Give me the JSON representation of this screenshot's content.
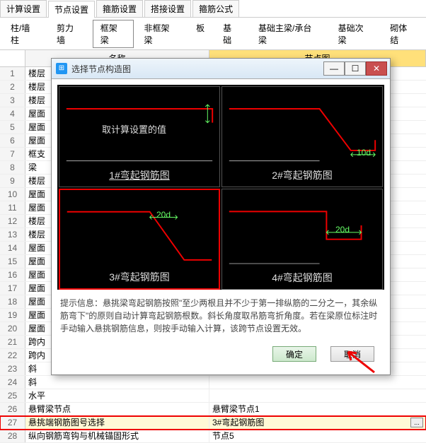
{
  "tabs_top": [
    "计算设置",
    "节点设置",
    "箍筋设置",
    "搭接设置",
    "箍筋公式"
  ],
  "tabs_top_active": 1,
  "tabs_sub": [
    "柱/墙柱",
    "剪力墙",
    "框架梁",
    "非框架梁",
    "板",
    "基础",
    "基础主梁/承台梁",
    "基础次梁",
    "砌体结"
  ],
  "tabs_sub_active": 2,
  "grid_headers": {
    "name": "名称",
    "img": "节点图"
  },
  "rows": [
    {
      "n": 1,
      "c1": "楼层",
      "c2": ""
    },
    {
      "n": 2,
      "c1": "楼层",
      "c2": ""
    },
    {
      "n": 3,
      "c1": "楼层",
      "c2": ""
    },
    {
      "n": 4,
      "c1": "屋面",
      "c2": ""
    },
    {
      "n": 5,
      "c1": "屋面",
      "c2": ""
    },
    {
      "n": 6,
      "c1": "屋面",
      "c2": ""
    },
    {
      "n": 7,
      "c1": "框支",
      "c2": ""
    },
    {
      "n": 8,
      "c1": "梁",
      "c2": ""
    },
    {
      "n": 9,
      "c1": "楼层",
      "c2": ""
    },
    {
      "n": 10,
      "c1": "屋面",
      "c2": ""
    },
    {
      "n": 11,
      "c1": "屋面",
      "c2": ""
    },
    {
      "n": 12,
      "c1": "楼层",
      "c2": ""
    },
    {
      "n": 13,
      "c1": "楼层",
      "c2": ""
    },
    {
      "n": 14,
      "c1": "屋面",
      "c2": ""
    },
    {
      "n": 15,
      "c1": "屋面",
      "c2": ""
    },
    {
      "n": 16,
      "c1": "屋面",
      "c2": ""
    },
    {
      "n": 17,
      "c1": "屋面",
      "c2": ""
    },
    {
      "n": 18,
      "c1": "屋面",
      "c2": ""
    },
    {
      "n": 19,
      "c1": "屋面",
      "c2": ""
    },
    {
      "n": 20,
      "c1": "屋面",
      "c2": ""
    },
    {
      "n": 21,
      "c1": "跨内",
      "c2": ""
    },
    {
      "n": 22,
      "c1": "跨内",
      "c2": ""
    },
    {
      "n": 23,
      "c1": "斜",
      "c2": ""
    },
    {
      "n": 24,
      "c1": "斜",
      "c2": ""
    },
    {
      "n": 25,
      "c1": "水平",
      "c2": ""
    },
    {
      "n": 26,
      "c1": "悬臂梁节点",
      "c2": "悬臂梁节点1"
    },
    {
      "n": 27,
      "c1": "悬挑端钢筋图号选择",
      "c2": "3#弯起钢筋图",
      "hl": true
    },
    {
      "n": 28,
      "c1": "纵向钢筋弯钩与机械锚固形式",
      "c2": "节点5"
    }
  ],
  "dialog": {
    "title": "选择节点构造图",
    "hint_label": "提示信息：",
    "hint_text": "悬挑梁弯起钢筋按照\"至少两根且并不少于第一排纵筋的二分之一，其余纵筋弯下\"的原则自动计算弯起钢筋根数。斜长角度取吊筋弯折角度。若在梁原位标注时手动输入悬挑钢筋信息，则按手动输入计算，该跨节点设置无效。",
    "ok": "确定",
    "cancel": "取消",
    "cells": [
      {
        "caption": "1#弯起钢筋图",
        "note": "取计算设置的值"
      },
      {
        "caption": "2#弯起钢筋图",
        "dim": "10d"
      },
      {
        "caption": "3#弯起钢筋图",
        "dim": "20d"
      },
      {
        "caption": "4#弯起钢筋图",
        "dim": "20d"
      }
    ]
  }
}
